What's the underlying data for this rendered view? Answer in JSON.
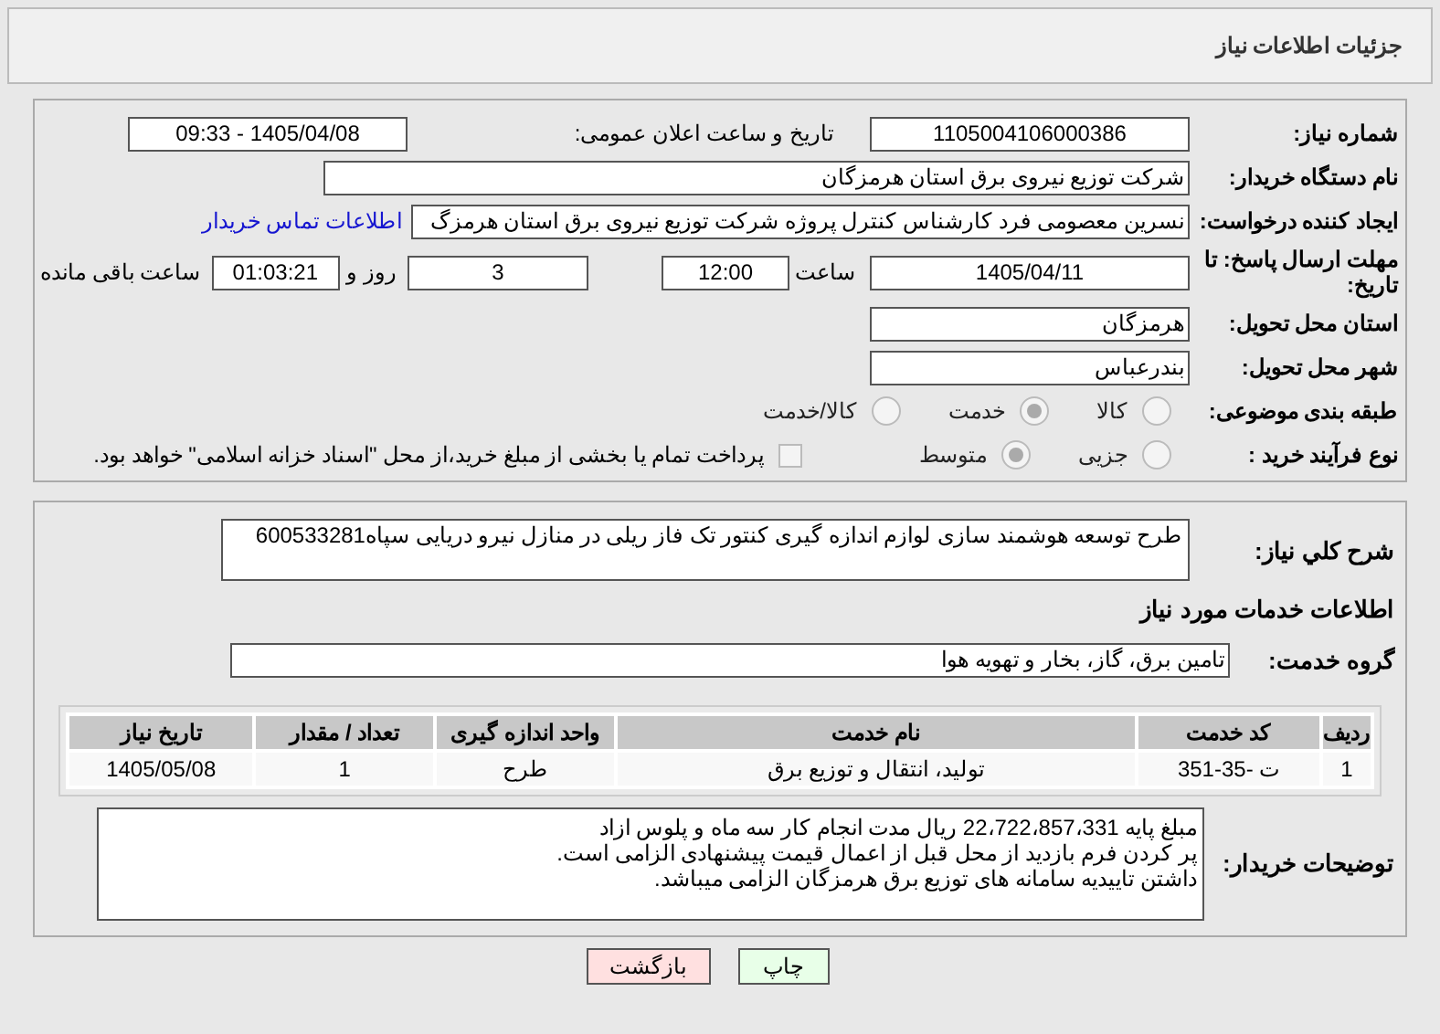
{
  "header": {
    "title": "جزئیات اطلاعات نیاز"
  },
  "need_number": {
    "label": "شماره نیاز:",
    "value": "1105004106000386"
  },
  "announce": {
    "label": "تاریخ و ساعت اعلان عمومی:",
    "value": "1405/04/08 - 09:33"
  },
  "buyer": {
    "label": "نام دستگاه خریدار:",
    "value": "شرکت توزیع نیروی برق استان هرمزگان"
  },
  "creator": {
    "label": "ایجاد کننده درخواست:",
    "value": "نسرین معصومی فرد کارشناس کنترل پروژه شرکت توزیع نیروی برق استان هرمزگ",
    "link": "اطلاعات تماس خریدار"
  },
  "deadline": {
    "label": "مهلت ارسال پاسخ: تا تاریخ:",
    "date": "1405/04/11",
    "time_label": "ساعت",
    "time": "12:00",
    "days": "3",
    "days_label": "روز و",
    "remaining": "01:03:21",
    "remaining_label": "ساعت باقی مانده"
  },
  "province": {
    "label": "استان محل تحویل:",
    "value": "هرمزگان"
  },
  "city": {
    "label": "شهر محل تحویل:",
    "value": "بندرعباس"
  },
  "category": {
    "label": "طبقه بندی موضوعی:",
    "options": [
      {
        "label": "کالا",
        "selected": false
      },
      {
        "label": "خدمت",
        "selected": true
      },
      {
        "label": "کالا/خدمت",
        "selected": false
      }
    ]
  },
  "process": {
    "label": "نوع فرآیند خرید :",
    "options": [
      {
        "label": "جزیی",
        "selected": false
      },
      {
        "label": "متوسط",
        "selected": true
      }
    ],
    "payment": {
      "checked": false,
      "text": "پرداخت تمام یا بخشی از مبلغ خرید،از محل \"اسناد خزانه اسلامی\" خواهد بود."
    }
  },
  "description": {
    "label": "شرح کلي نياز:",
    "value": "طرح توسعه هوشمند سازی لوازم اندازه گیری کنتور تک فاز ریلی در منازل نیرو دریایی سپاه600533281"
  },
  "services_title": "اطلاعات خدمات مورد نیاز",
  "service_group": {
    "label": "گروه خدمت:",
    "value": "تامین برق، گاز، بخار و تهویه هوا"
  },
  "table": {
    "columns": [
      "ردیف",
      "کد خدمت",
      "نام خدمت",
      "واحد اندازه گیری",
      "تعداد / مقدار",
      "تاریخ نیاز"
    ],
    "rows": [
      [
        "1",
        "ت -35-351",
        "تولید، انتقال و توزیع برق",
        "طرح",
        "1",
        "1405/05/08"
      ]
    ]
  },
  "buyer_notes": {
    "label": "توضیحات خریدار:",
    "lines": [
      "مبلغ پایه 22،722،857،331  ریال مدت انجام کار سه ماه و پلوس ازاد",
      "پر کردن فرم بازدید از محل قبل از اعمال قیمت پیشنهادی الزامی است.",
      "داشتن تاییدیه سامانه های توزیع برق هرمزگان الزامی میباشد."
    ]
  },
  "buttons": [
    {
      "kind": "print",
      "label": "چاپ"
    },
    {
      "kind": "back",
      "label": "بازگشت"
    }
  ]
}
